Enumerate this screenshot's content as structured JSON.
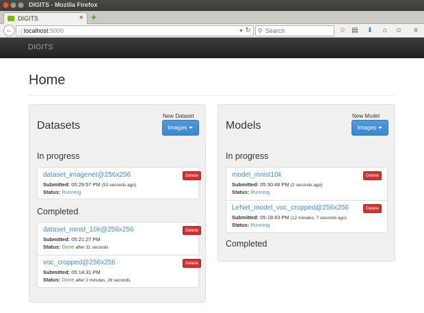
{
  "window": {
    "title": "DIGITS - Mozilla Firefox"
  },
  "browser": {
    "tab_title": "DIGITS",
    "url_host": "localhost",
    "url_port": ":5000",
    "search_placeholder": "Search"
  },
  "app": {
    "brand": "DIGITS"
  },
  "page": {
    "title": "Home"
  },
  "datasets": {
    "title": "Datasets",
    "new_label": "New Dataset",
    "new_button": "Images",
    "in_progress_title": "In progress",
    "completed_title": "Completed",
    "in_progress": [
      {
        "name": "dataset_imagenet@256x256",
        "submitted_label": "Submitted:",
        "submitted": "05:29:57 PM",
        "submitted_ago": "(53 seconds ago)",
        "status_label": "Status:",
        "status": "Running",
        "status_detail": "",
        "delete": "Delete"
      }
    ],
    "completed": [
      {
        "name": "dataset_minst_10k@256x256",
        "submitted_label": "Submitted:",
        "submitted": "05:21:27 PM",
        "submitted_ago": "",
        "status_label": "Status:",
        "status": "Done",
        "status_detail": "after 31 seconds",
        "delete": "Delete"
      },
      {
        "name": "voc_cropped@256x256",
        "submitted_label": "Submitted:",
        "submitted": "05:14:31 PM",
        "submitted_ago": "",
        "status_label": "Status:",
        "status": "Done",
        "status_detail": "after 2 minutes, 26 seconds",
        "delete": "Delete"
      }
    ]
  },
  "models": {
    "title": "Models",
    "new_label": "New Model",
    "new_button": "Images",
    "in_progress_title": "In progress",
    "completed_title": "Completed",
    "in_progress": [
      {
        "name": "model_mnist10k",
        "submitted_label": "Submitted:",
        "submitted": "05:30:48 PM",
        "submitted_ago": "(2 seconds ago)",
        "status_label": "Status:",
        "status": "Running",
        "status_detail": "",
        "delete": "Delete"
      },
      {
        "name": "LeNet_model_voc_cropped@256x256",
        "submitted_label": "Submitted:",
        "submitted": "05:18:43 PM",
        "submitted_ago": "(12 minutes, 7 seconds ago)",
        "status_label": "Status:",
        "status": "Running",
        "status_detail": "",
        "delete": "Delete"
      }
    ]
  },
  "colors": {
    "accent": "#428bca",
    "danger": "#d2322d",
    "success": "#3c9c3c"
  }
}
